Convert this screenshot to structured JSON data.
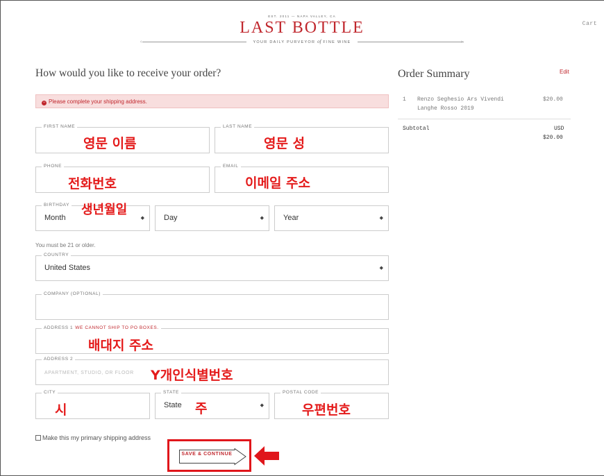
{
  "header": {
    "est": "EST. 2011 — NAPA VALLEY, CA",
    "logo": "LAST BOTTLE",
    "tagline_left": "YOUR DAILY PURVEYOR",
    "tagline_of": "of",
    "tagline_right": "FINE WINE",
    "cart": "Cart"
  },
  "form": {
    "heading": "How would you like to receive your order?",
    "alert": "Please complete your shipping address.",
    "first_name": {
      "label": "FIRST NAME",
      "annotation": "영문 이름"
    },
    "last_name": {
      "label": "LAST NAME",
      "annotation": "영문 성"
    },
    "phone": {
      "label": "PHONE",
      "annotation": "전화번호"
    },
    "email": {
      "label": "EMAIL",
      "annotation": "이메일 주소"
    },
    "birthday": {
      "label": "BIRTHDAY",
      "annotation": "생년월일",
      "month": "Month",
      "day": "Day",
      "year": "Year"
    },
    "age_note": "You must be 21 or older.",
    "country": {
      "label": "COUNTRY",
      "value": "United States"
    },
    "company": {
      "label": "COMPANY (OPTIONAL)"
    },
    "address1": {
      "label": "ADDRESS 1",
      "warning": "WE CANNOT SHIP TO PO BOXES.",
      "annotation": "배대지 주소"
    },
    "address2": {
      "label": "ADDRESS 2",
      "placeholder": "APARTMENT, STUDIO, OR FLOOR",
      "annotation": "Y개인식별번호"
    },
    "city": {
      "label": "CITY",
      "annotation": "시"
    },
    "state": {
      "label": "STATE",
      "value": "State",
      "annotation": "주"
    },
    "postal": {
      "label": "POSTAL CODE",
      "annotation": "우편번호"
    },
    "primary_checkbox": "Make this my primary shipping address",
    "submit": "SAVE & CONTINUE"
  },
  "summary": {
    "heading": "Order Summary",
    "edit": "Edit",
    "item": {
      "qty": "1",
      "name_line1": "Renzo Seghesio Ars Vivendi",
      "name_line2": "Langhe Rosso 2019",
      "price": "$20.00"
    },
    "subtotal_label": "Subtotal",
    "currency": "USD",
    "subtotal_value": "$20.00"
  },
  "colors": {
    "brand": "#c0272d",
    "annotation": "#e41b1b"
  }
}
